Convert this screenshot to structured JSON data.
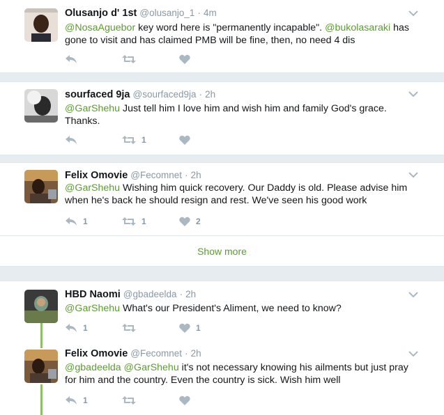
{
  "colors": {
    "mention": "#5a9e2d",
    "muted": "#8899a6",
    "thread": "#8fbf6a"
  },
  "tweets": [
    {
      "name": "Olusanjo d' 1st",
      "handle": "@olusanjo_1",
      "dot": "·",
      "time": "4m",
      "m1": "@NosaAguebor",
      "t1": " key word here is \"permanently incapable\". ",
      "m2": "@bukolasaraki",
      "t2": " has gone to visit and has claimed PMB will be fine, then, no need 4 dis",
      "reply_count": "",
      "retweet_count": "",
      "like_count": ""
    },
    {
      "name": "sourfaced 9ja",
      "handle": "@sourfaced9ja",
      "dot": "·",
      "time": "2h",
      "m1": "@GarShehu",
      "t1": " Just tell him I love him and wish him and family God's grace. Thanks.",
      "m2": "",
      "t2": "",
      "reply_count": "",
      "retweet_count": "1",
      "like_count": ""
    },
    {
      "name": "Felix Omovie",
      "handle": "@Fecomnet",
      "dot": "·",
      "time": "2h",
      "m1": "@GarShehu",
      "t1": " Wishing him quick recovery. Our Daddy is old. Please advise him when he's back he should resign and rest. We've seen his good work",
      "m2": "",
      "t2": "",
      "reply_count": "1",
      "retweet_count": "1",
      "like_count": "2"
    },
    {
      "name": "HBD Naomi",
      "handle": "@gbadeelda",
      "dot": "·",
      "time": "2h",
      "m1": "@GarShehu",
      "t1": " What's our President's Aliment, we need to know?",
      "m2": "",
      "t2": "",
      "reply_count": "1",
      "retweet_count": "",
      "like_count": "1"
    },
    {
      "name": "Felix Omovie",
      "handle": "@Fecomnet",
      "dot": "·",
      "time": "2h",
      "m1": "@gbadeelda",
      "t1": " ",
      "m2": "@GarShehu",
      "t2": " it's not necessary knowing his ailments but just pray for him and the country. Even the country is sick. Wish him well",
      "reply_count": "1",
      "retweet_count": "",
      "like_count": ""
    }
  ],
  "show_more": "Show more"
}
